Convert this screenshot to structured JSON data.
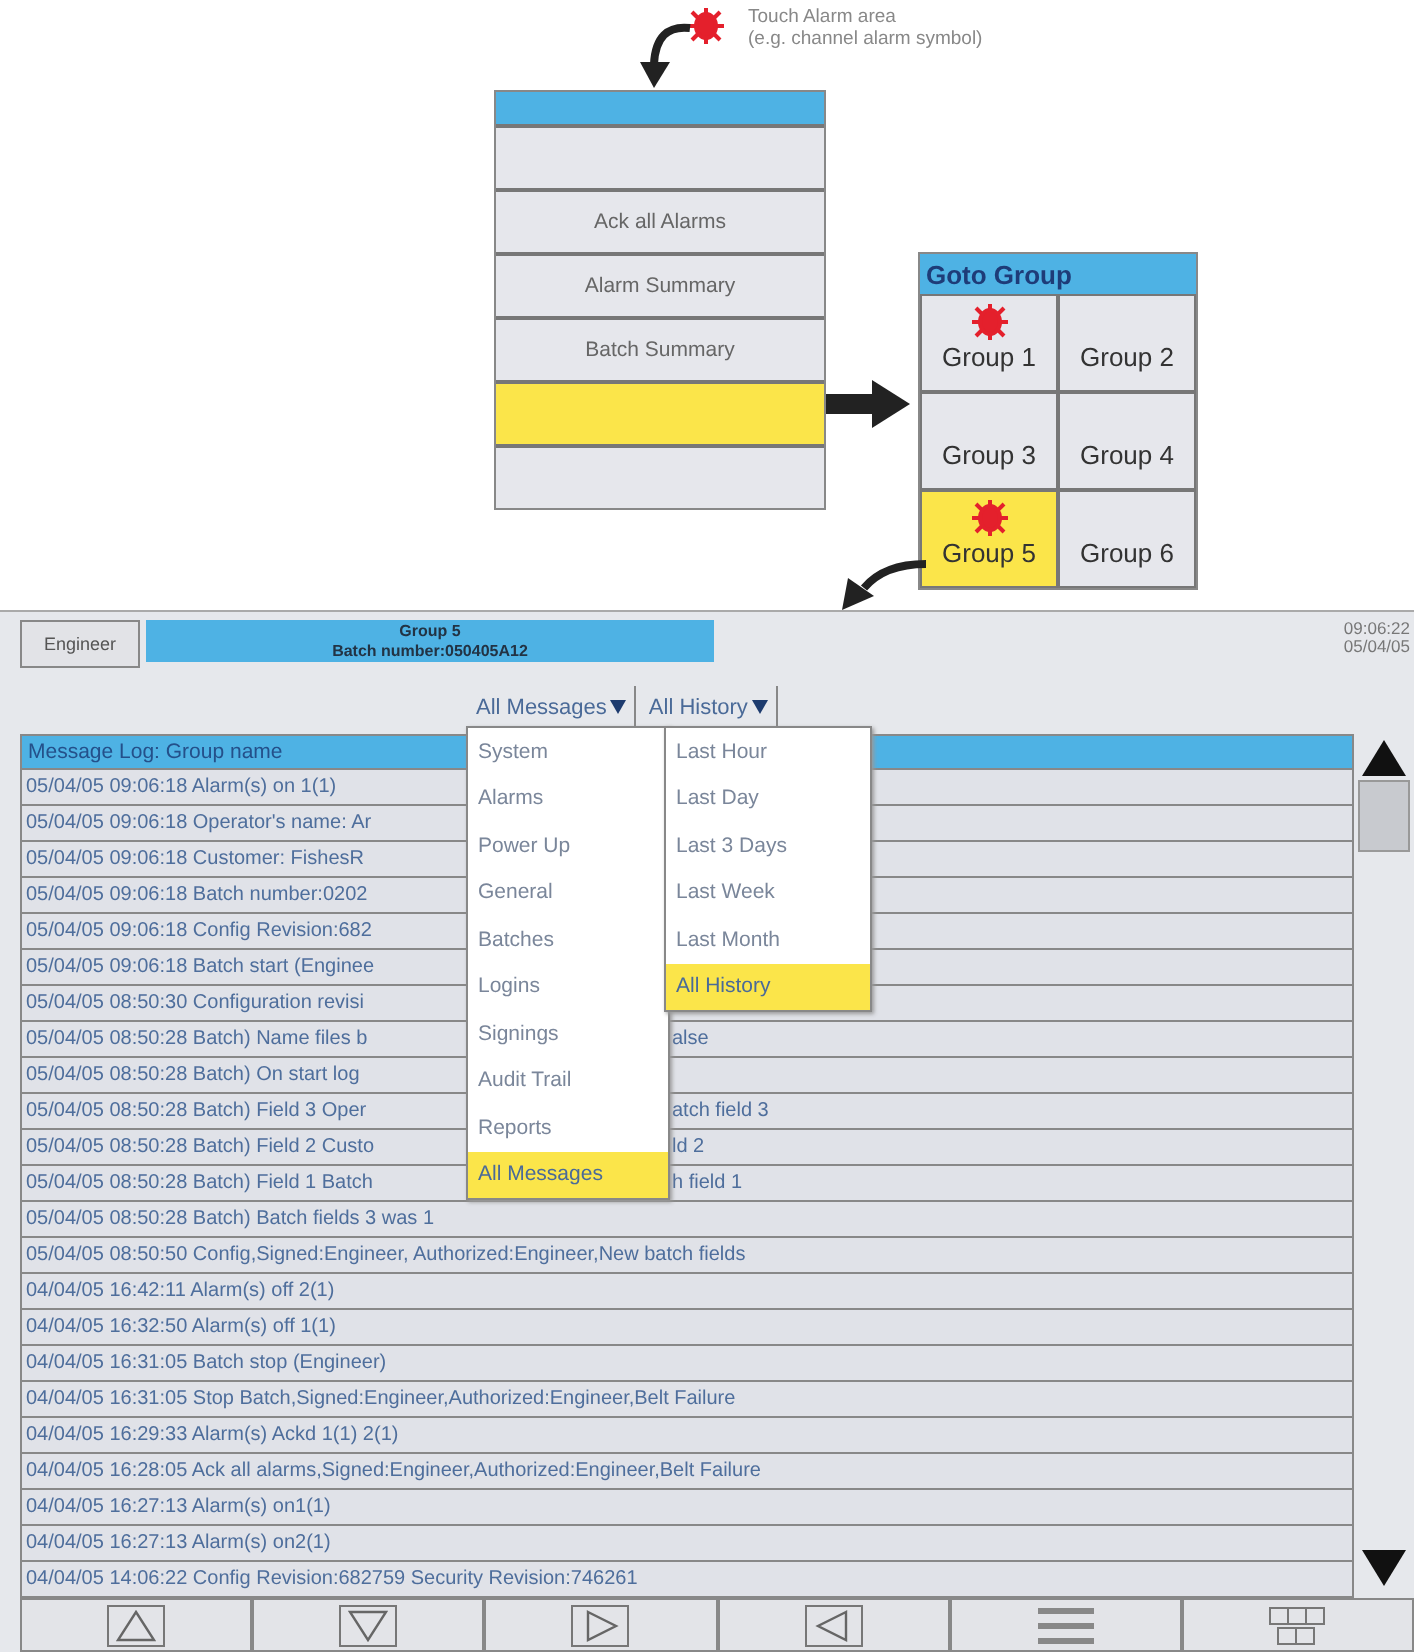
{
  "diagram": {
    "callout_lines": [
      "Touch Alarm area",
      "(e.g. channel alarm symbol)"
    ],
    "menu": {
      "items": [
        {
          "kind": "blank",
          "selected": false
        },
        {
          "kind": "item",
          "label": "Ack all Alarms",
          "selected": false
        },
        {
          "kind": "item",
          "label": "Alarm Summary",
          "selected": false
        },
        {
          "kind": "item",
          "label": "Batch Summary",
          "selected": false
        },
        {
          "kind": "blank",
          "selected": true
        },
        {
          "kind": "blank",
          "selected": false
        }
      ]
    },
    "goto_group": {
      "title": "Goto Group",
      "groups": [
        {
          "label": "Group 1",
          "alarm": true,
          "selected": false
        },
        {
          "label": "Group 2",
          "alarm": false,
          "selected": false
        },
        {
          "label": "Group 3",
          "alarm": false,
          "selected": false
        },
        {
          "label": "Group 4",
          "alarm": false,
          "selected": false
        },
        {
          "label": "Group 5",
          "alarm": true,
          "selected": true
        },
        {
          "label": "Group 6",
          "alarm": false,
          "selected": false
        }
      ]
    }
  },
  "screen": {
    "user_button": "Engineer",
    "banner": {
      "title": "Group 5",
      "batch": "Batch number:050405A12"
    },
    "time": "09:06:22",
    "date": "05/04/05",
    "filters": [
      {
        "label": "All Messages",
        "expanded": true,
        "options": [
          {
            "label": "System",
            "selected": false
          },
          {
            "label": "Alarms",
            "selected": false
          },
          {
            "label": "Power Up",
            "selected": false
          },
          {
            "label": "General",
            "selected": false
          },
          {
            "label": "Batches",
            "selected": false
          },
          {
            "label": "Logins",
            "selected": false
          },
          {
            "label": "Signings",
            "selected": false
          },
          {
            "label": "Audit Trail",
            "selected": false
          },
          {
            "label": "Reports",
            "selected": false
          },
          {
            "label": "All Messages",
            "selected": true
          }
        ]
      },
      {
        "label": "All History",
        "expanded": true,
        "options": [
          {
            "label": "Last Hour",
            "selected": false
          },
          {
            "label": "Last Day",
            "selected": false
          },
          {
            "label": "Last 3 Days",
            "selected": false
          },
          {
            "label": "Last Week",
            "selected": false
          },
          {
            "label": "Last Month",
            "selected": false
          },
          {
            "label": "All History",
            "selected": true
          }
        ]
      }
    ],
    "log": {
      "title": "Message Log: Group name",
      "rows": [
        {
          "text": "05/04/05 09:06:18 Alarm(s) on 1(1)"
        },
        {
          "text": "05/04/05 09:06:18 Operator's name: Ar"
        },
        {
          "text": "05/04/05 09:06:18 Customer: FishesR"
        },
        {
          "text": "05/04/05 09:06:18 Batch number:0202"
        },
        {
          "text": "05/04/05 09:06:18 Config Revision:682"
        },
        {
          "text": "05/04/05 09:06:18 Batch start (Enginee"
        },
        {
          "text": "05/04/05 08:50:30 Configuration revisi"
        },
        {
          "text": "05/04/05 08:50:28 Batch) Name files b",
          "tail": "alse"
        },
        {
          "text": "05/04/05 08:50:28 Batch) On start log"
        },
        {
          "text": "05/04/05 08:50:28 Batch) Field 3 Oper",
          "tail": "atch field 3"
        },
        {
          "text": "05/04/05 08:50:28 Batch) Field 2 Custo",
          "tail": "ld 2"
        },
        {
          "text": "05/04/05 08:50:28 Batch) Field 1 Batch",
          "tail": "h field 1"
        },
        {
          "text": "05/04/05 08:50:28 Batch) Batch fields 3 was 1"
        },
        {
          "text": "05/04/05 08:50:50 Config,Signed:Engineer, Authorized:Engineer,New batch fields"
        },
        {
          "text": "04/04/05 16:42:11 Alarm(s) off 2(1)"
        },
        {
          "text": "04/04/05 16:32:50 Alarm(s) off 1(1)"
        },
        {
          "text": "04/04/05 16:31:05 Batch stop (Engineer)"
        },
        {
          "text": "04/04/05 16:31:05 Stop Batch,Signed:Engineer,Authorized:Engineer,Belt Failure"
        },
        {
          "text": "04/04/05 16:29:33 Alarm(s) Ackd 1(1) 2(1)"
        },
        {
          "text": "04/04/05 16:28:05 Ack all alarms,Signed:Engineer,Authorized:Engineer,Belt Failure"
        },
        {
          "text": "04/04/05 16:27:13 Alarm(s) on1(1)"
        },
        {
          "text": "04/04/05 16:27:13 Alarm(s) on2(1)"
        },
        {
          "text": "04/04/05 14:06:22 Config Revision:682759 Security Revision:746261"
        }
      ]
    },
    "toolbar": [
      {
        "kind": "up"
      },
      {
        "kind": "down"
      },
      {
        "kind": "right"
      },
      {
        "kind": "left"
      },
      {
        "kind": "menu"
      },
      {
        "kind": "grid"
      }
    ]
  }
}
